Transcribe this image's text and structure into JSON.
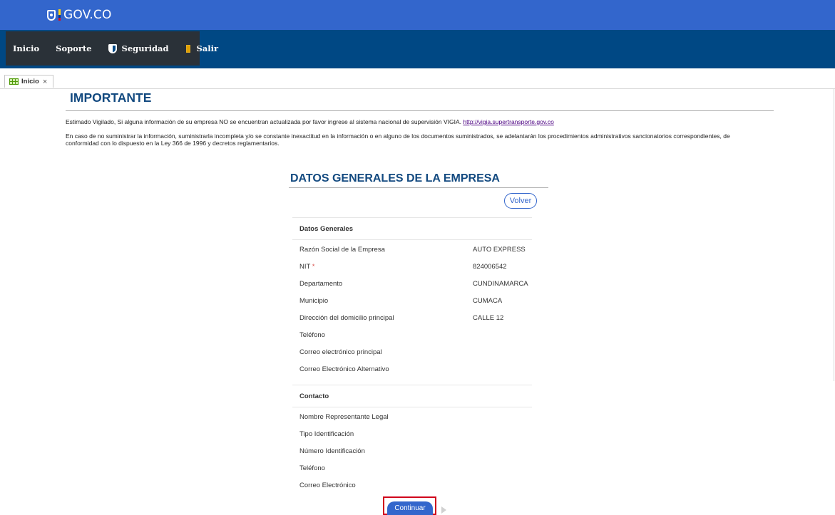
{
  "gov_header": {
    "logo_text": "GOV.CO",
    "bg_color": "#3366cc"
  },
  "nav": {
    "bg_color": "#004884",
    "items": [
      {
        "label": "Inicio",
        "icon": ""
      },
      {
        "label": "Soporte",
        "icon": ""
      },
      {
        "label": "Seguridad",
        "icon": "shield-icon"
      },
      {
        "label": "Salir",
        "icon": "door-icon"
      }
    ]
  },
  "tab": {
    "label": "Inicio",
    "close": "×"
  },
  "important": {
    "title": "IMPORTANTE",
    "p1_text": "Estimado Vigilado, Si alguna información de su empresa NO se encuentran actualizada por favor ingrese al sistema nacional de supervisión VIGIA.",
    "p1_link": "http://vigia.supertransporte.gov.co",
    "p2_text": "En caso de no suministrar la información, suministrarla incompleta y/o se constante inexactitud en la información o en alguno de los documentos suministrados, se adelantarán los procedimientos administrativos sancionatorios correspondientes, de conformidad con lo dispuesto en la Ley 366 de 1996 y decretos reglamentarios."
  },
  "form": {
    "title": "DATOS GENERALES DE LA EMPRESA",
    "volver_label": "Volver",
    "general_section": "Datos Generales",
    "general_rows": [
      {
        "label": "Razón Social de la Empresa",
        "value": "AUTO EXPRESS"
      },
      {
        "label": "NIT",
        "required": "*",
        "value": "824006542"
      },
      {
        "label": "Departamento",
        "value": "CUNDINAMARCA"
      },
      {
        "label": "Municipio",
        "value": "CUMACA"
      },
      {
        "label": "Dirección del domicilio principal",
        "value": "CALLE 12"
      },
      {
        "label": "Teléfono",
        "value": ""
      },
      {
        "label": "Correo electrónico principal",
        "value": ""
      },
      {
        "label": "Correo Electrónico Alternativo",
        "value": ""
      }
    ],
    "contact_section": "Contacto",
    "contact_rows": [
      {
        "label": "Nombre Representante Legal"
      },
      {
        "label": "Tipo Identificación"
      },
      {
        "label": "Número Identificación"
      },
      {
        "label": "Teléfono"
      },
      {
        "label": "Correo Electrónico"
      }
    ],
    "continuar_label": "Continuar"
  },
  "colors": {
    "accent": "#3366cc",
    "title": "#134a80",
    "highlight_border": "#d0021b"
  }
}
